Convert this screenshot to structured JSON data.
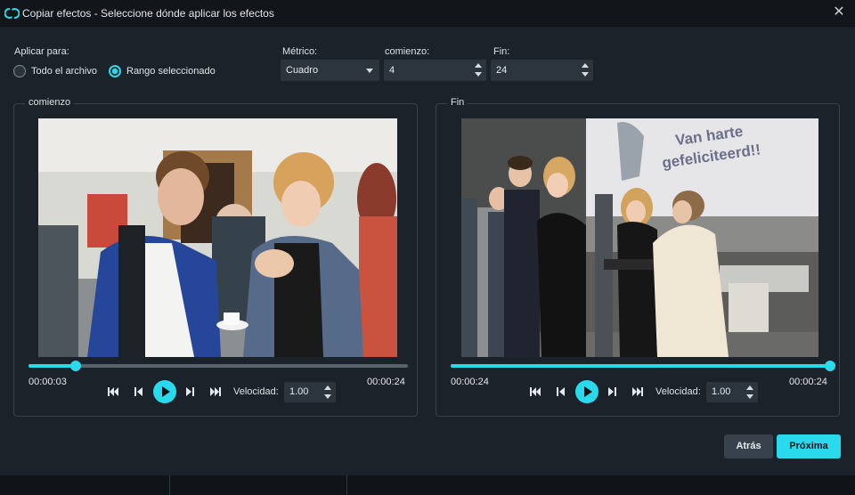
{
  "window": {
    "title": "Copiar efectos - Seleccione dónde aplicar los efectos"
  },
  "apply": {
    "label": "Aplicar para:",
    "options": [
      {
        "label": "Todo el archivo",
        "selected": false
      },
      {
        "label": "Rango seleccionado",
        "selected": true
      }
    ]
  },
  "metric": {
    "label": "Métrico:",
    "value": "Cuadro"
  },
  "start": {
    "label": "comienzo:",
    "value": "4"
  },
  "end": {
    "label": "Fin:",
    "value": "24"
  },
  "left_panel": {
    "title": "comienzo",
    "current_time": "00:00:03",
    "total_time": "00:00:24",
    "progress": 0.125,
    "speed_label": "Velocidad:",
    "speed_value": "1.00"
  },
  "right_panel": {
    "title": "Fin",
    "current_time": "00:00:24",
    "total_time": "00:00:24",
    "progress": 1.0,
    "speed_label": "Velocidad:",
    "speed_value": "1.00",
    "screen_text_line1": "Van harte",
    "screen_text_line2": "gefeliciteerd!!"
  },
  "buttons": {
    "back": "Atrás",
    "next": "Próxima"
  },
  "colors": {
    "accent": "#29d9ec",
    "background": "#1b2229"
  },
  "icons": [
    "app-logo-icon",
    "close-icon",
    "skip-start-icon",
    "step-back-icon",
    "play-icon",
    "step-forward-icon",
    "skip-end-icon",
    "chevron-down-icon"
  ]
}
